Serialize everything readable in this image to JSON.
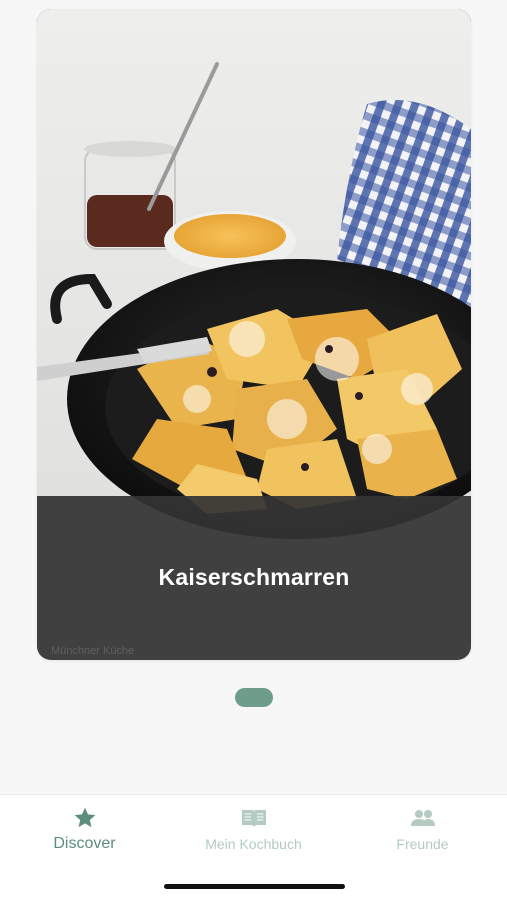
{
  "colors": {
    "accent": "#5d8e7b",
    "accent_light": "#b3cbc0",
    "pager": "#6e9e8b",
    "overlay": "#343434"
  },
  "card": {
    "title": "Kaiserschmarren",
    "source": "Münchner Küche",
    "image_icon": "photo-kaiserschmarren"
  },
  "pager": {
    "current_page": 1,
    "total_pages": 1
  },
  "tabbar": {
    "tabs": [
      {
        "label": "Discover",
        "icon": "star-icon",
        "active": true
      },
      {
        "label": "Mein Kochbuch",
        "icon": "book-icon",
        "active": false
      },
      {
        "label": "Freunde",
        "icon": "people-icon",
        "active": false
      }
    ]
  }
}
